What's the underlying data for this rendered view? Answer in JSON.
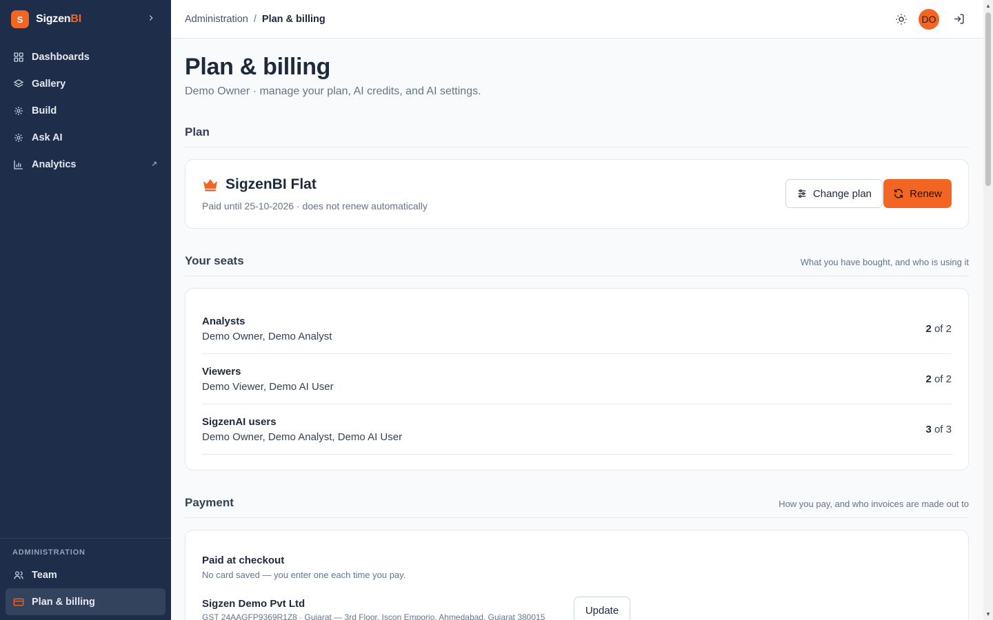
{
  "brand": {
    "logo_letter": "S",
    "name_main": "Sigzen",
    "name_accent": "BI",
    "accent_color": "#f26522"
  },
  "sidebar": {
    "items": [
      {
        "label": "Dashboards",
        "icon": "grid-icon"
      },
      {
        "label": "Gallery",
        "icon": "layers-icon"
      },
      {
        "label": "Build",
        "icon": "sparkle-icon"
      },
      {
        "label": "Ask AI",
        "icon": "sparkle-icon"
      },
      {
        "label": "Analytics",
        "icon": "bar-chart-icon",
        "external": true
      }
    ],
    "admin_label": "ADMINISTRATION",
    "admin_items": [
      {
        "label": "Team",
        "icon": "users-icon"
      },
      {
        "label": "Plan & billing",
        "icon": "credit-card-icon",
        "active": true
      }
    ]
  },
  "breadcrumb": {
    "parent": "Administration",
    "separator": "/",
    "current": "Plan & billing"
  },
  "topbar": {
    "avatar_initials": "DO"
  },
  "page": {
    "title": "Plan & billing",
    "subtitle": "Demo Owner · manage your plan, AI credits, and AI settings."
  },
  "plan_section": {
    "title": "Plan",
    "plan_name": "SigzenBI Flat",
    "plan_status": "Paid until 25-10-2026 · does not renew automatically",
    "change_label": "Change plan",
    "renew_label": "Renew"
  },
  "seats_section": {
    "title": "Your seats",
    "note": "What you have bought, and who is using it",
    "rows": [
      {
        "name": "Analysts",
        "users": "Demo Owner, Demo Analyst",
        "used": "2",
        "of": "of 2"
      },
      {
        "name": "Viewers",
        "users": "Demo Viewer, Demo AI User",
        "used": "2",
        "of": "of 2"
      },
      {
        "name": "SigzenAI users",
        "users": "Demo Owner, Demo Analyst, Demo AI User",
        "used": "3",
        "of": "of 3"
      }
    ]
  },
  "payment_section": {
    "title": "Payment",
    "note": "How you pay, and who invoices are made out to",
    "method_title": "Paid at checkout",
    "method_note": "No card saved — you enter one each time you pay.",
    "company_name": "Sigzen Demo Pvt Ltd",
    "company_detail": "GST 24AAGFP9369R1Z8 · Gujarat — 3rd Floor, Iscon Emporio, Ahmedabad, Gujarat 380015",
    "update_label": "Update"
  }
}
